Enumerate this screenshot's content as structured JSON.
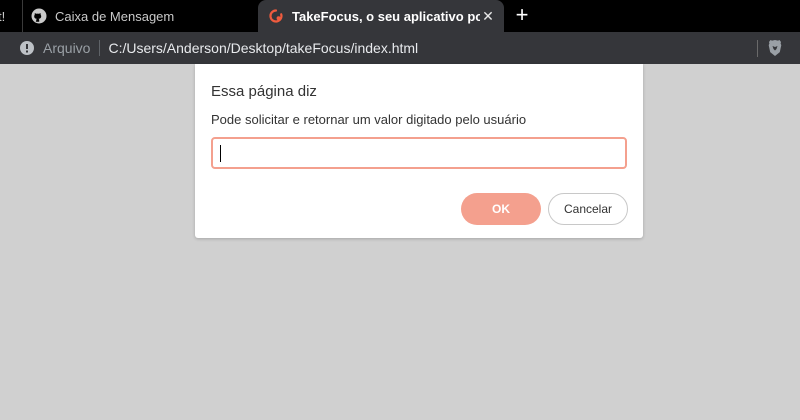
{
  "tabs": [
    {
      "title": "t!",
      "state": "partial"
    },
    {
      "title": "Caixa de Mensagem",
      "icon": "github-icon",
      "state": "inactive"
    },
    {
      "title": "TakeFocus, o seu aplicativo pomodoro",
      "icon": "takefocus-icon",
      "state": "active"
    }
  ],
  "toolbar": {
    "site_label": "Arquivo",
    "url": "C:/Users/Anderson/Desktop/takeFocus/index.html"
  },
  "dialog": {
    "title": "Essa página diz",
    "message": "Pode solicitar e retornar um valor digitado pelo usuário",
    "input_value": "",
    "ok_label": "OK",
    "cancel_label": "Cancelar"
  },
  "colors": {
    "accent": "#f4a08e",
    "page_background": "#d0d0d0",
    "toolbar": "#35363a"
  }
}
